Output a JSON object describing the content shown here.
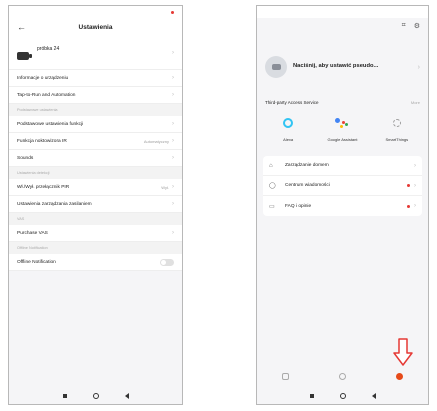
{
  "left": {
    "status": {
      "time": "",
      "right": ""
    },
    "header": {
      "title": "Ustawienia"
    },
    "device": {
      "name": "próbka 24"
    },
    "rows_a": [
      {
        "label": "Informacje o urządzeniu"
      },
      {
        "label": "Tap-to-Run and Automation"
      }
    ],
    "section1": "Podstawowe ustawienia",
    "rows_b": [
      {
        "label": "Podstawowe ustawienia funkcji",
        "value": ""
      },
      {
        "label": "Funkcja noktowizora IR",
        "value": "Automatyczny"
      },
      {
        "label": "Sounds",
        "value": ""
      }
    ],
    "section2": "Ustawienia detekcji",
    "rows_c": [
      {
        "label": "Wł./Wył. przełącznik PIR",
        "value": "Wył."
      },
      {
        "label": "Ustawienia zarządzania zasilaniem",
        "value": ""
      }
    ],
    "section3": "VAS",
    "rows_d": [
      {
        "label": "Purchase VAS"
      }
    ],
    "section4": "Offline Notification",
    "rows_e": [
      {
        "label": "Offline Notification"
      }
    ]
  },
  "right": {
    "status": {
      "time": "",
      "right": ""
    },
    "topicons": {
      "scan": "⌗",
      "settings": "⚙"
    },
    "profile": {
      "title": "Naciśnij, aby ustawić pseudo...",
      "subtitle": ""
    },
    "tps": {
      "title": "Third-party Access Service",
      "more": "More"
    },
    "services": [
      {
        "name": "Alexa"
      },
      {
        "name": "Google Assistant"
      },
      {
        "name": "SmartThings"
      }
    ],
    "menu": [
      {
        "label": "Zarządzanie domem",
        "icon": "home-icon"
      },
      {
        "label": "Centrum wiadomości",
        "icon": "message-icon"
      },
      {
        "label": "FAQ i opinie",
        "icon": "faq-icon"
      }
    ],
    "tabs": [
      {
        "label": ""
      },
      {
        "label": ""
      },
      {
        "label": ""
      }
    ],
    "arrow_color": "#e53935",
    "dot_color": "#e53935"
  }
}
